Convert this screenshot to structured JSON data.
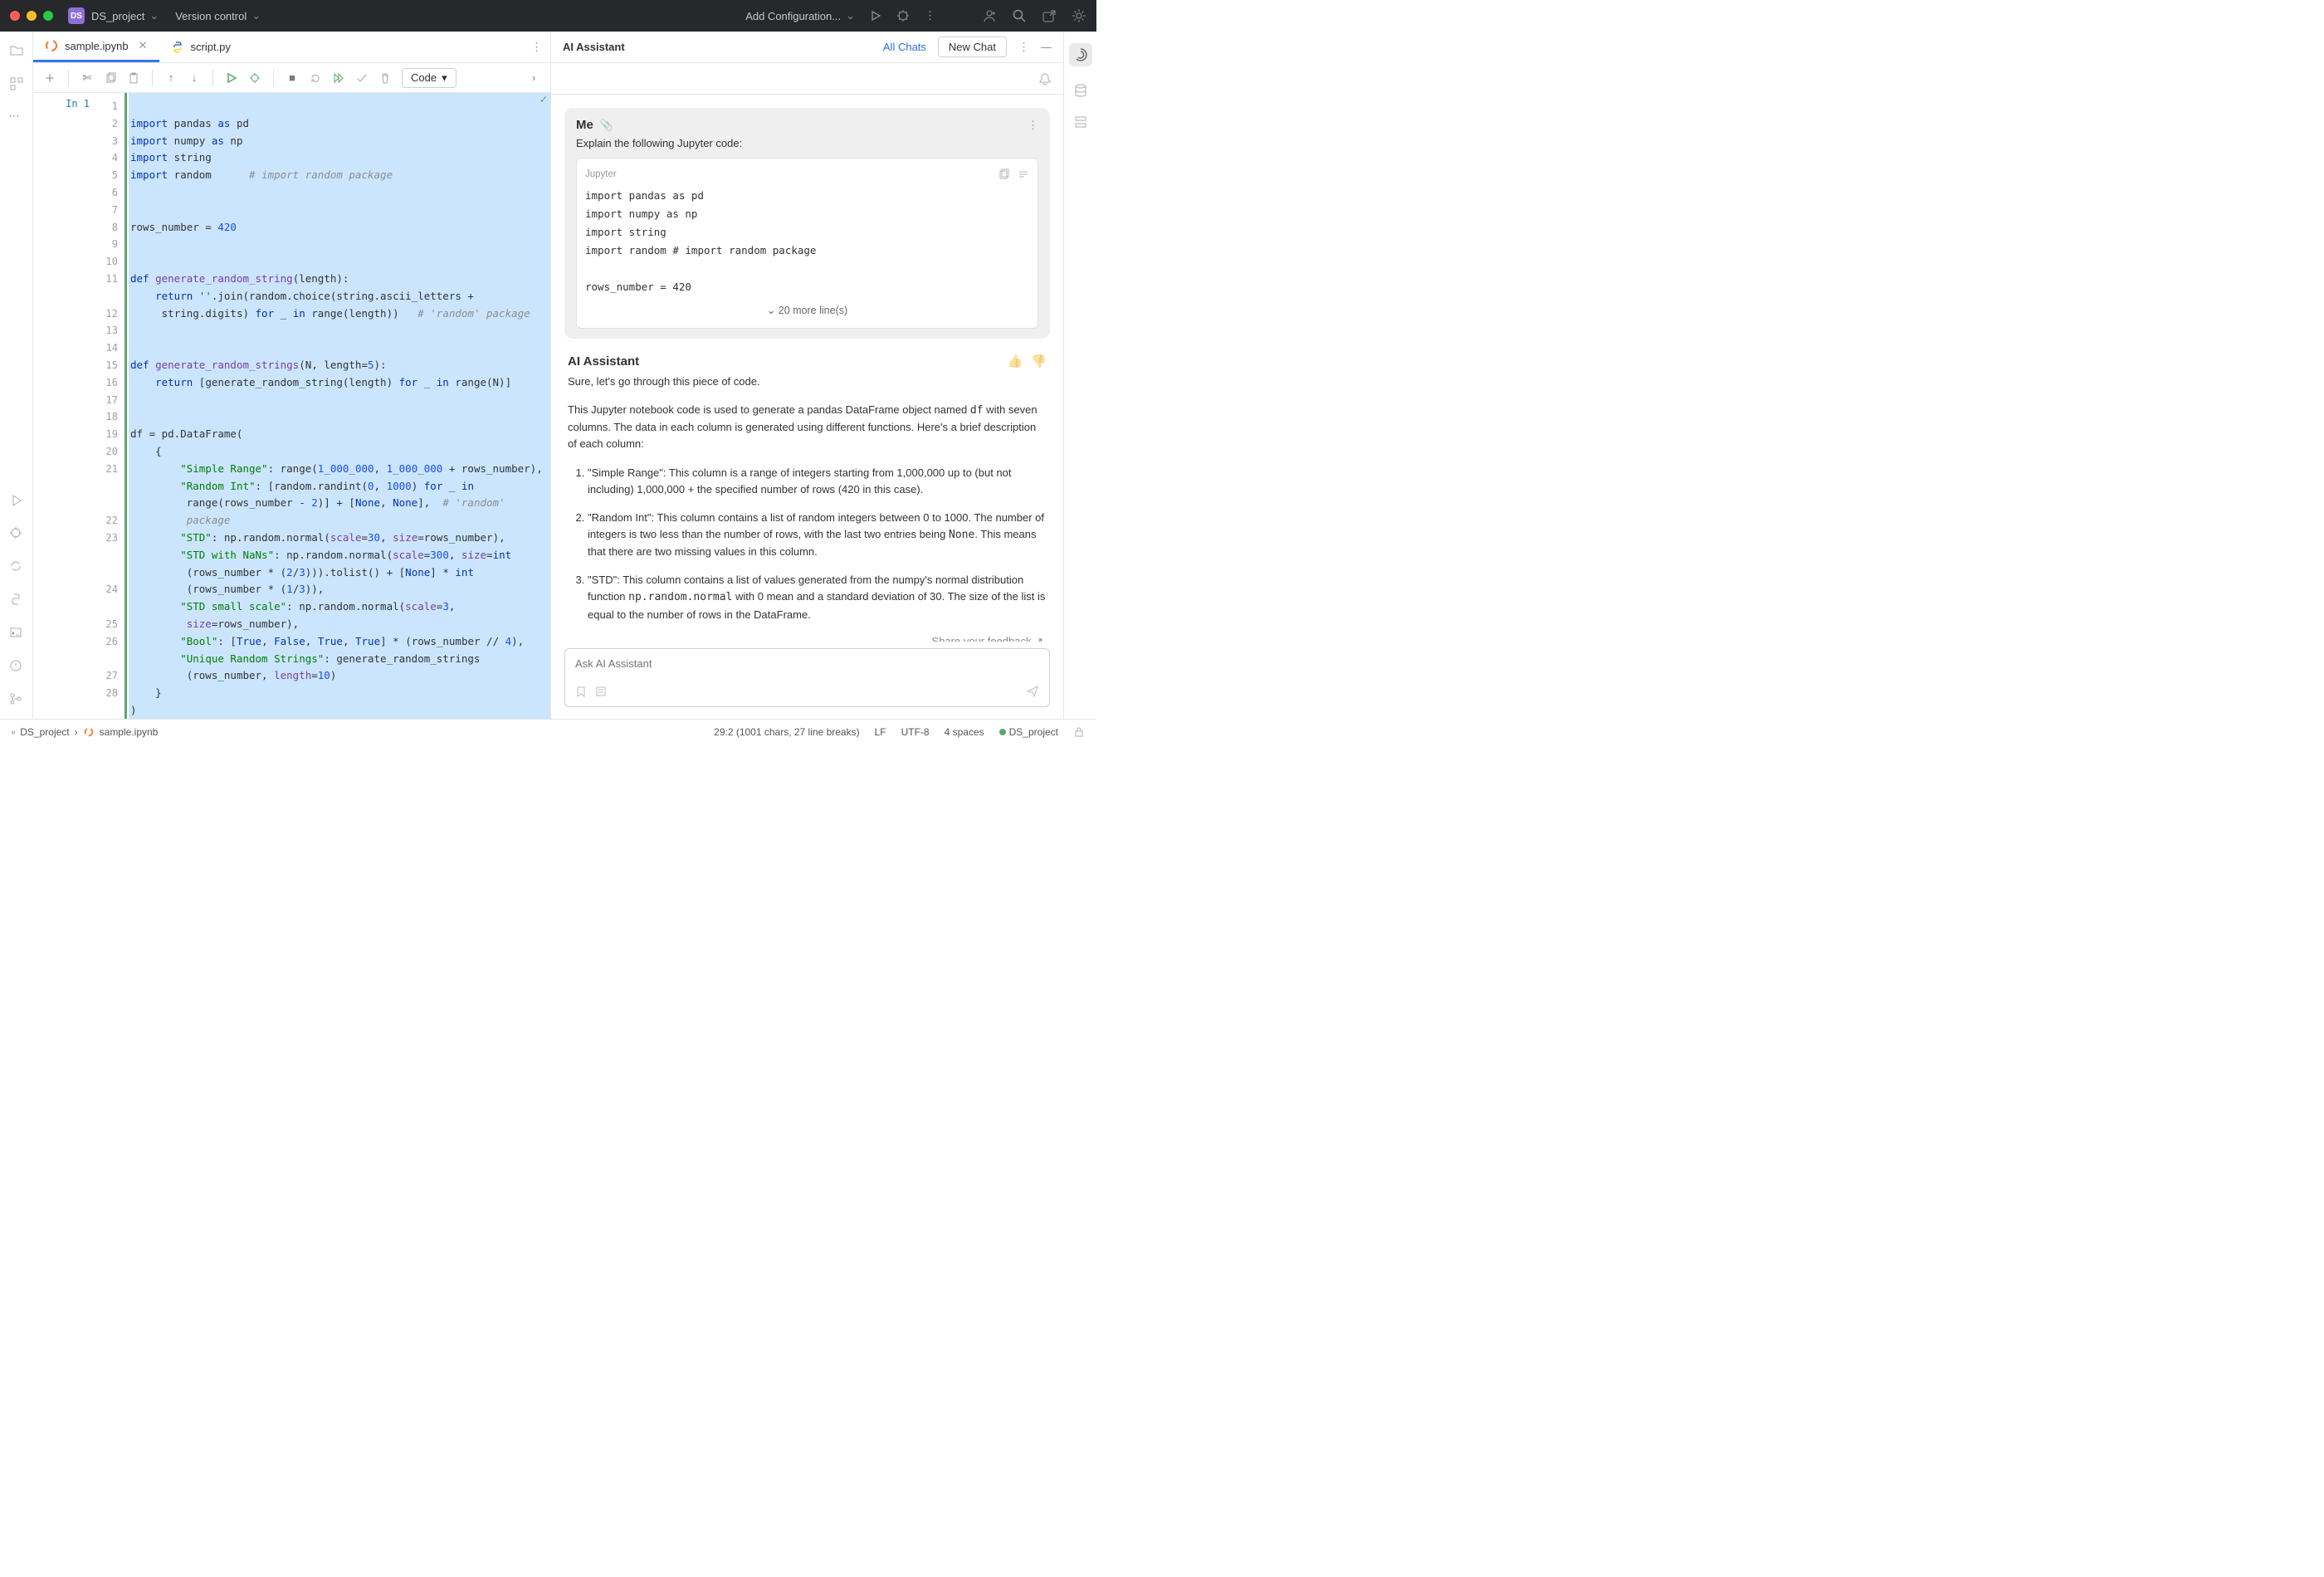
{
  "titlebar": {
    "project_badge": "DS",
    "project_name": "DS_project",
    "version_control": "Version control",
    "run_config": "Add Configuration..."
  },
  "tabs": [
    {
      "label": "sample.ipynb",
      "active": true
    },
    {
      "label": "script.py",
      "active": false
    }
  ],
  "toolbar": {
    "cell_type": "Code"
  },
  "editor": {
    "in_label": "In 1",
    "line_numbers": [
      1,
      2,
      3,
      4,
      5,
      6,
      7,
      8,
      9,
      10,
      11,
      "",
      12,
      13,
      14,
      15,
      16,
      17,
      18,
      19,
      20,
      21,
      "",
      "",
      22,
      23,
      "",
      "",
      24,
      "",
      25,
      26,
      "",
      27,
      28
    ]
  },
  "code": {
    "l1": {
      "kw1": "import",
      "id": " pandas ",
      "kw2": "as",
      "al": " pd"
    },
    "l2": {
      "kw1": "import",
      "id": " numpy ",
      "kw2": "as",
      "al": " np"
    },
    "l3": {
      "kw1": "import",
      "id": " string"
    },
    "l4": {
      "kw1": "import",
      "id": " random      ",
      "cm": "# import random package"
    },
    "l7": {
      "a": "rows_number = ",
      "n": "420"
    },
    "l10": {
      "kw": "def ",
      "fn": "generate_random_string",
      "rest": "(length):"
    },
    "l11": {
      "pad": "    ",
      "kw": "return ",
      "s": "''",
      "rest": ".join(random.choice(string.ascii_letters +"
    },
    "l11b": {
      "pad": "     ",
      "rest": "string.digits) ",
      "kw1": "for",
      "mid": " _ ",
      "kw2": "in",
      "mid2": " range(length))   ",
      "cm": "# 'random' package"
    },
    "l14": {
      "kw": "def ",
      "fn": "generate_random_strings",
      "a": "(N, length=",
      "n": "5",
      "b": "):"
    },
    "l15": {
      "pad": "    ",
      "kw": "return ",
      "a": "[generate_random_string(length) ",
      "kw1": "for",
      "mid": " _ ",
      "kw2": "in",
      "mid2": " range(N)]"
    },
    "l18": "df = pd.DataFrame(",
    "l19": "    {",
    "l20": {
      "pad": "        ",
      "s": "\"Simple Range\"",
      "a": ": range(",
      "n1": "1_000_000",
      "b": ", ",
      "n2": "1_000_000",
      "c": " + rows_number),"
    },
    "l21": {
      "pad": "        ",
      "s": "\"Random Int\"",
      "a": ": [random.randint(",
      "n1": "0",
      "b": ", ",
      "n2": "1000",
      "c": ") ",
      "kw1": "for",
      "mid": " _ ",
      "kw2": "in"
    },
    "l21b": {
      "pad": "         ",
      "a": "range(rows_number - ",
      "n": "2",
      "b": ")] + [",
      "bl1": "None",
      "c": ", ",
      "bl2": "None",
      "d": "],  ",
      "cm": "# 'random'"
    },
    "l21c": {
      "pad": "         ",
      "cm": "package"
    },
    "l22": {
      "pad": "        ",
      "s": "\"STD\"",
      "a": ": np.random.normal(",
      "p1": "scale",
      "eq": "=",
      "n1": "30",
      "b": ", ",
      "p2": "size",
      "eq2": "=",
      "c": "rows_number),"
    },
    "l23": {
      "pad": "        ",
      "s": "\"STD with NaNs\"",
      "a": ": np.random.normal(",
      "p1": "scale",
      "eq": "=",
      "n1": "300",
      "b": ", ",
      "p2": "size",
      "eq2": "=",
      "ty": "int"
    },
    "l23b": {
      "pad": "         ",
      "a": "(rows_number * (",
      "n1": "2",
      "b": "/",
      "n2": "3",
      "c": "))).tolist() + [",
      "bl": "None",
      "d": "] * ",
      "ty": "int"
    },
    "l23c": {
      "pad": "         ",
      "a": "(rows_number * (",
      "n1": "1",
      "b": "/",
      "n2": "3",
      "c": ")),"
    },
    "l24": {
      "pad": "        ",
      "s": "\"STD small scale\"",
      "a": ": np.random.normal(",
      "p1": "scale",
      "eq": "=",
      "n1": "3",
      "b": ","
    },
    "l24b": {
      "pad": "         ",
      "p": "size",
      "eq": "=",
      "a": "rows_number),"
    },
    "l25": {
      "pad": "        ",
      "s": "\"Bool\"",
      "a": ": [",
      "b1": "True",
      "c1": ", ",
      "b2": "False",
      "c2": ", ",
      "b3": "True",
      "c3": ", ",
      "b4": "True",
      "d": "] * (rows_number // ",
      "n": "4",
      "e": "),"
    },
    "l26": {
      "pad": "        ",
      "s": "\"Unique Random Strings\"",
      "a": ": generate_random_strings"
    },
    "l26b": {
      "pad": "         ",
      "a": "(rows_number, ",
      "p": "length",
      "eq": "=",
      "n": "10",
      "b": ")"
    },
    "l27": "    }",
    "l28": ")"
  },
  "ai": {
    "title": "AI Assistant",
    "all_chats": "All Chats",
    "new_chat": "New Chat",
    "me_label": "Me",
    "me_prompt": "Explain the following Jupyter code:",
    "me_code_header": "Jupyter",
    "me_code_lines": [
      "import pandas as pd",
      "import numpy as np",
      "import string",
      "import random      # import random package",
      "",
      "rows_number = 420"
    ],
    "more_lines": "20 more line(s)",
    "assistant_label": "AI Assistant",
    "assistant_intro": "Sure, let's go through this piece of code.",
    "assistant_p1_a": "This Jupyter notebook code is used to generate a pandas DataFrame object named ",
    "assistant_p1_df": "df",
    "assistant_p1_b": " with seven columns. The data in each column is generated using different functions. Here's a brief description of each column:",
    "li1": "\"Simple Range\": This column is a range of integers starting from 1,000,000 up to (but not including) 1,000,000 + the specified number of rows (420 in this case).",
    "li2_a": "\"Random Int\": This column contains a list of random integers between 0 to 1000. The number of integers is two less than the number of rows, with the last two entries being ",
    "li2_none": "None",
    "li2_b": ". This means that there are two missing values in this column.",
    "li3_a": "\"STD\": This column contains a list of values generated from the numpy's normal distribution function ",
    "li3_fn": "np.random.normal",
    "li3_b": " with 0 mean and a standard deviation of 30. The size of the list is equal to the number of rows in the DataFrame.",
    "feedback": "Share your feedback ↗",
    "input_placeholder": "Ask AI Assistant"
  },
  "statusbar": {
    "crumb1": "DS_project",
    "crumb2": "sample.ipynb",
    "pos": "29:2 (1001 chars, 27 line breaks)",
    "eol": "LF",
    "enc": "UTF-8",
    "indent": "4 spaces",
    "interp": "DS_project"
  }
}
